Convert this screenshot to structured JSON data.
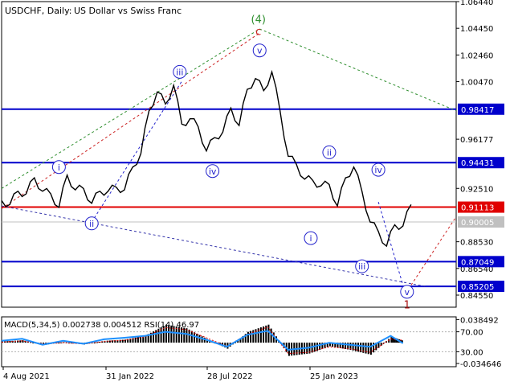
{
  "header": {
    "symbol": "USDCHF, Daily:",
    "description": "US Dollar vs Swiss Franc"
  },
  "chart_data": [
    {
      "type": "line",
      "title": "USDCHF, Daily:  US Dollar vs Swiss Franc",
      "ylim": [
        0.8365,
        1.0644
      ],
      "y_ticks": [
        "1.06440",
        "1.04450",
        "1.02460",
        "1.00470",
        "0.96177",
        "0.92510",
        "0.88530",
        "0.86540",
        "0.84550"
      ],
      "x_ticks": [
        "4 Aug 2021",
        "31 Jan 2022",
        "28 Jul 2022",
        "25 Jan 2023"
      ],
      "price_line": {
        "x": [
          0,
          20,
          40,
          60,
          80,
          100,
          120,
          140,
          160,
          180,
          200,
          220,
          240,
          260,
          280,
          300,
          320,
          340,
          360,
          380,
          400,
          420,
          440,
          460,
          480,
          500,
          520,
          540,
          560,
          580,
          600,
          620,
          640,
          660,
          680,
          700,
          720,
          740,
          760,
          780,
          800,
          820,
          840,
          860,
          880,
          900,
          920,
          940,
          960,
          980,
          1000
        ],
        "y": [
          0.913,
          0.916,
          0.92,
          0.924,
          0.93,
          0.926,
          0.918,
          0.914,
          0.932,
          0.927,
          0.922,
          0.917,
          0.92,
          0.926,
          0.923,
          0.927,
          0.938,
          0.954,
          0.98,
          1.0,
          0.985,
          1.005,
          0.97,
          0.98,
          0.968,
          0.956,
          0.96,
          0.97,
          0.982,
          0.975,
          0.996,
          1.01,
          0.995,
          1.015,
          0.98,
          0.952,
          0.94,
          0.935,
          0.928,
          0.93,
          0.925,
          0.915,
          0.93,
          0.944,
          0.92,
          0.903,
          0.89,
          0.885,
          0.895,
          0.9,
          0.91
        ]
      },
      "horizontal_levels": [
        {
          "value": 0.98417,
          "label": "0.98417",
          "color": "#0000cc",
          "label_bg": "#0000cc"
        },
        {
          "value": 0.94431,
          "label": "0.94431",
          "color": "#0000cc",
          "label_bg": "#0000cc"
        },
        {
          "value": 0.91113,
          "label": "0.91113",
          "color": "#e00000",
          "label_bg": "#e00000"
        },
        {
          "value": 0.87049,
          "label": "0.87049",
          "color": "#0000cc",
          "label_bg": "#0000cc"
        },
        {
          "value": 0.85205,
          "label": "0.85205",
          "color": "#0000cc",
          "label_bg": "#0000cc"
        },
        {
          "value": 0.90005,
          "label": "0.90005",
          "color": "#c0c0c0",
          "label_bg": "#c0c0c0"
        }
      ],
      "wave_labels": [
        {
          "text": "(4)",
          "x": 627,
          "y": 1.051,
          "color": "#2f8f2f",
          "style": "plain"
        },
        {
          "text": "c",
          "x": 627,
          "y": 1.042,
          "color": "#cc2222",
          "style": "plain"
        },
        {
          "text": "i",
          "x": 140,
          "y": 0.941,
          "color": "#2222cc",
          "style": "circle"
        },
        {
          "text": "ii",
          "x": 220,
          "y": 0.899,
          "color": "#2222cc",
          "style": "circle"
        },
        {
          "text": "iii",
          "x": 435,
          "y": 1.012,
          "color": "#2222cc",
          "style": "circle"
        },
        {
          "text": "iv",
          "x": 515,
          "y": 0.938,
          "color": "#2222cc",
          "style": "circle"
        },
        {
          "text": "v",
          "x": 630,
          "y": 1.028,
          "color": "#2222cc",
          "style": "circle"
        },
        {
          "text": "ii",
          "x": 800,
          "y": 0.952,
          "color": "#2222cc",
          "style": "circle"
        },
        {
          "text": "i",
          "x": 755,
          "y": 0.888,
          "color": "#2222cc",
          "style": "circle"
        },
        {
          "text": "iv",
          "x": 920,
          "y": 0.939,
          "color": "#2222cc",
          "style": "circle"
        },
        {
          "text": "iii",
          "x": 880,
          "y": 0.867,
          "color": "#2222cc",
          "style": "circle"
        },
        {
          "text": "v",
          "x": 990,
          "y": 0.848,
          "color": "#2222cc",
          "style": "circle"
        },
        {
          "text": "1",
          "x": 990,
          "y": 0.838,
          "color": "#aa1111",
          "style": "plain"
        }
      ],
      "trend_lines": [
        {
          "from": [
            0,
            0.925
          ],
          "to": [
            630,
            1.044
          ],
          "color": "#2f8f2f",
          "dash": "3,3"
        },
        {
          "from": [
            630,
            1.044
          ],
          "to": [
            1110,
            0.983
          ],
          "color": "#2f8f2f",
          "dash": "3,3"
        },
        {
          "from": [
            0,
            0.91
          ],
          "to": [
            630,
            1.041
          ],
          "color": "#cc2222",
          "dash": "3,3"
        },
        {
          "from": [
            0,
            0.912
          ],
          "to": [
            1035,
            0.852
          ],
          "color": "#3333aa",
          "dash": "3,3"
        },
        {
          "from": [
            920,
            0.915
          ],
          "to": [
            980,
            0.853
          ],
          "color": "#2222cc",
          "dash": "3,3"
        },
        {
          "from": [
            1000,
            0.853
          ],
          "to": [
            1110,
            0.904
          ],
          "color": "#cc2222",
          "dash": "3,3"
        },
        {
          "from": [
            220,
            0.9
          ],
          "to": [
            440,
            1.005
          ],
          "color": "#2222cc",
          "dash": "3,3"
        }
      ],
      "x_domain": [
        0,
        1110
      ]
    },
    {
      "type": "line",
      "title": "MACD(5,34,5) 0.002738 0.004512 RSI(14) 46.97",
      "ylim": [
        -0.04,
        0.043
      ],
      "y_ticks": [
        "0.038492",
        "70.00",
        "30.00",
        "-0.034646"
      ],
      "rsi_levels": [
        70,
        30
      ],
      "macd_series": {
        "x": [
          0,
          50,
          100,
          150,
          200,
          250,
          300,
          350,
          400,
          450,
          500,
          550,
          600,
          650,
          700,
          750,
          800,
          850,
          900,
          950,
          980
        ],
        "y": [
          0.002,
          0.004,
          -0.004,
          0.001,
          -0.003,
          0.003,
          0.005,
          0.012,
          0.03,
          0.024,
          0.006,
          -0.01,
          0.018,
          0.03,
          -0.022,
          -0.018,
          -0.006,
          -0.012,
          -0.02,
          0.01,
          0.003
        ]
      },
      "signal_series": {
        "x": [
          0,
          50,
          100,
          150,
          200,
          250,
          300,
          350,
          400,
          450,
          500,
          550,
          600,
          650,
          700,
          750,
          800,
          850,
          900,
          950,
          980
        ],
        "y": [
          0.001,
          0.003,
          -0.002,
          0.0,
          -0.002,
          0.002,
          0.004,
          0.01,
          0.025,
          0.022,
          0.008,
          -0.006,
          0.014,
          0.026,
          -0.018,
          -0.016,
          -0.007,
          -0.01,
          -0.016,
          0.006,
          0.004
        ]
      },
      "rsi_series": {
        "x": [
          0,
          50,
          100,
          150,
          200,
          250,
          300,
          350,
          400,
          450,
          500,
          550,
          600,
          650,
          700,
          750,
          800,
          850,
          900,
          950,
          980
        ],
        "y": [
          52,
          56,
          44,
          52,
          46,
          55,
          58,
          62,
          70,
          66,
          54,
          40,
          64,
          72,
          34,
          38,
          48,
          44,
          40,
          62,
          47
        ]
      },
      "x_domain": [
        0,
        1110
      ]
    }
  ]
}
